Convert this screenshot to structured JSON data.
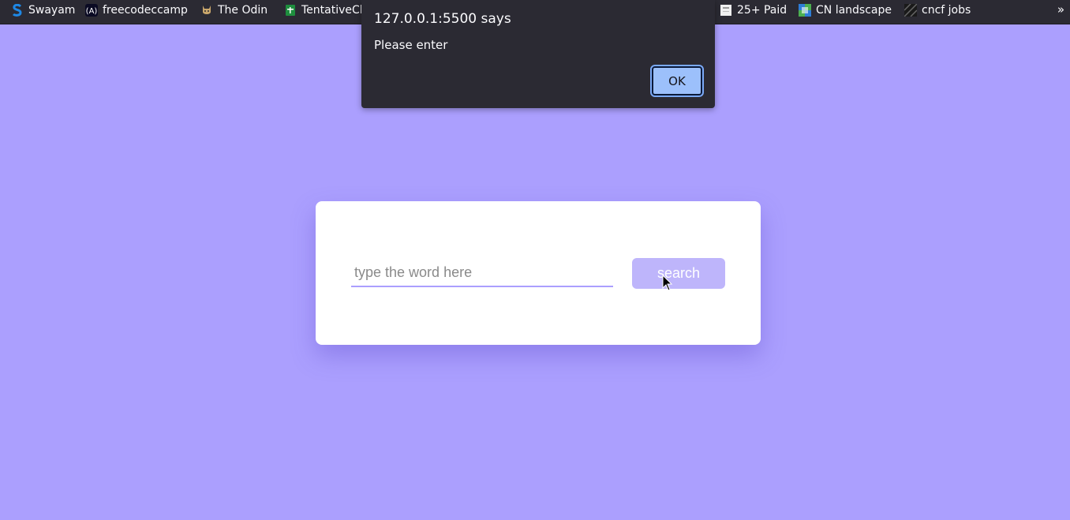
{
  "bookmarks": [
    {
      "label": "Swayam",
      "icon": "swayam-s-icon",
      "color": "#1e88e5"
    },
    {
      "label": "freecodeccamp",
      "icon": "freecodecamp-icon",
      "color": "#0a0a23"
    },
    {
      "label": "The Odin",
      "icon": "odin-icon",
      "color": "#c9a66b"
    },
    {
      "label": "TentativeCl",
      "icon": "sheets-icon",
      "color": "#1e8e3e"
    },
    {
      "label": "25+ Paid",
      "icon": "document-icon",
      "color": "#ffffff"
    },
    {
      "label": "CN landscape",
      "icon": "cn-landscape-icon",
      "color": "#2e7dd7"
    },
    {
      "label": "cncf jobs",
      "icon": "cncf-jobs-icon",
      "color": "#444444"
    }
  ],
  "bookmarks_overflow": "»",
  "alert": {
    "title": "127.0.0.1:5500 says",
    "message": "Please enter",
    "ok_label": "OK"
  },
  "search": {
    "placeholder": "type the word here",
    "value": "",
    "button_label": "search"
  },
  "colors": {
    "page_background": "#ab9ffe",
    "button_background": "#beb5fb",
    "toolbar_background": "#2b2a33",
    "ok_button": "#9cc0fb"
  }
}
